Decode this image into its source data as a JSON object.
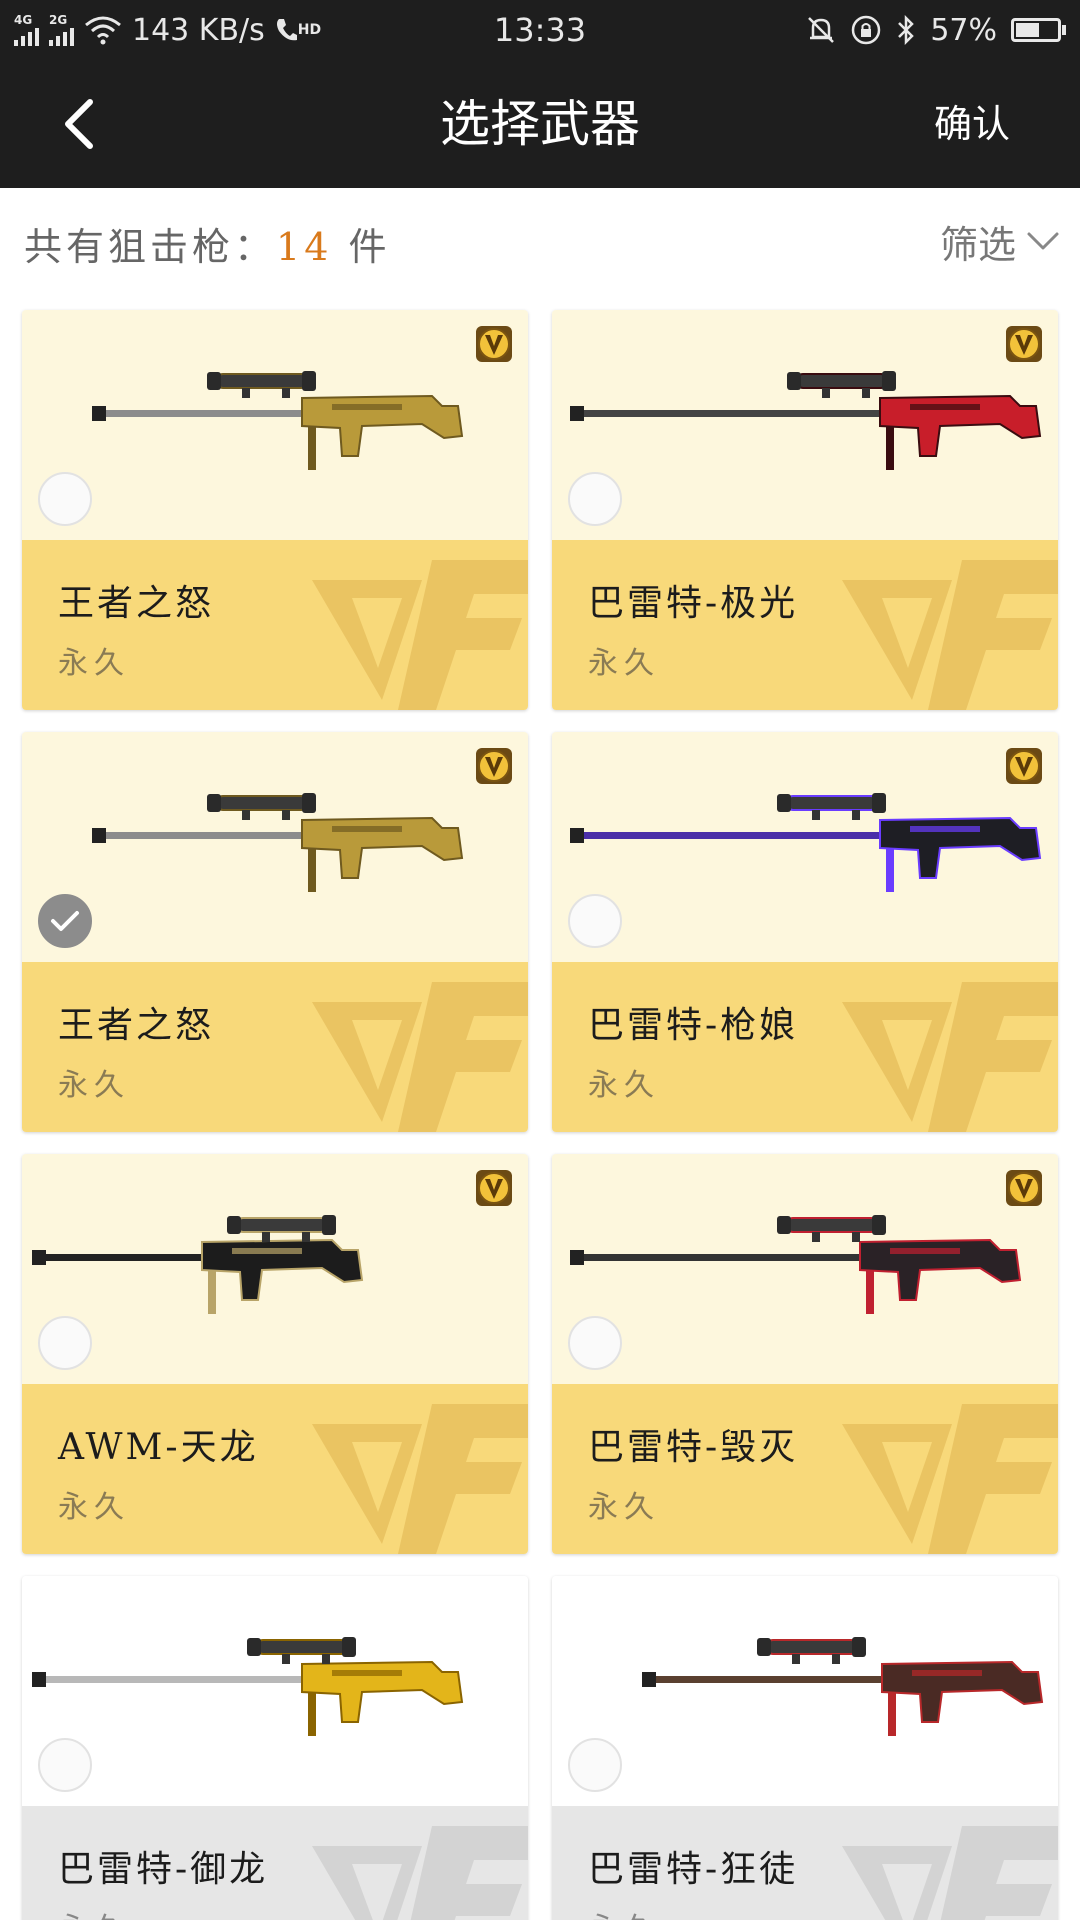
{
  "status_bar": {
    "network_1": "4G",
    "network_2": "2G",
    "speed": "143 KB/s",
    "hd": "HD",
    "time": "13:33",
    "battery_text": "57%",
    "battery_level": 0.57
  },
  "header": {
    "title": "选择武器",
    "confirm_label": "确认"
  },
  "filter_row": {
    "count_prefix": "共有狙击枪：",
    "count_value": "14",
    "count_suffix": " 件",
    "filter_label": "筛选"
  },
  "colors": {
    "header_bg": "#1e1e1e",
    "card_top": "#fdf7dd",
    "card_bottom": "#f8d97a",
    "accent": "#d97a1c",
    "checked": "#8c8c8c"
  },
  "weapons": [
    {
      "name": "王者之怒",
      "duration": "永久",
      "vip": true,
      "checked": false,
      "icon": "gold-sniper-rifle"
    },
    {
      "name": "巴雷特-极光",
      "duration": "永久",
      "vip": true,
      "checked": false,
      "icon": "red-sniper-rifle"
    },
    {
      "name": "王者之怒",
      "duration": "永久",
      "vip": true,
      "checked": true,
      "icon": "gold-sniper-rifle"
    },
    {
      "name": "巴雷特-枪娘",
      "duration": "永久",
      "vip": true,
      "checked": false,
      "icon": "purple-sniper-rifle"
    },
    {
      "name": "AWM-天龙",
      "duration": "永久",
      "vip": true,
      "checked": false,
      "icon": "black-awm-rifle"
    },
    {
      "name": "巴雷特-毁灭",
      "duration": "永久",
      "vip": true,
      "checked": false,
      "icon": "dark-red-sniper-rifle"
    },
    {
      "name": "巴雷特-御龙",
      "duration": "永久",
      "vip": false,
      "checked": false,
      "icon": "gold-dragon-rifle"
    },
    {
      "name": "巴雷特-狂徒",
      "duration": "永久",
      "vip": false,
      "checked": false,
      "icon": "red-black-rifle"
    }
  ]
}
